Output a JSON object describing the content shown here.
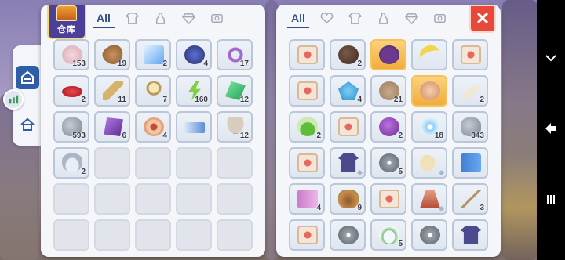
{
  "left_panel": {
    "warehouse_label": "仓库",
    "tabs": [
      {
        "label": "All",
        "active": true
      },
      {
        "icon": "shirt-icon"
      },
      {
        "icon": "bottle-icon"
      },
      {
        "icon": "gem-icon"
      },
      {
        "icon": "card-icon"
      }
    ],
    "slots": [
      {
        "icon": "i-unicorn",
        "qty": "153"
      },
      {
        "icon": "i-seed",
        "qty": "19"
      },
      {
        "icon": "i-blue",
        "qty": "2"
      },
      {
        "icon": "i-whale",
        "qty": "4"
      },
      {
        "icon": "i-swirl",
        "qty": "17"
      },
      {
        "icon": "i-ruby",
        "qty": "2"
      },
      {
        "icon": "i-feather",
        "qty": "11"
      },
      {
        "icon": "i-mirror",
        "qty": "7"
      },
      {
        "icon": "i-bolt",
        "qty": "160"
      },
      {
        "icon": "i-emerald",
        "qty": "12"
      },
      {
        "icon": "i-stone",
        "qty": "593"
      },
      {
        "icon": "i-purplecube",
        "qty": "6"
      },
      {
        "icon": "i-eye",
        "qty": "4"
      },
      {
        "icon": "i-ticket",
        "qty": ""
      },
      {
        "icon": "i-mushroom",
        "qty": "12"
      },
      {
        "icon": "i-bottle",
        "qty": "2"
      },
      {
        "empty": true
      },
      {
        "empty": true
      },
      {
        "empty": true
      },
      {
        "empty": true
      },
      {
        "empty": true
      },
      {
        "empty": true
      },
      {
        "empty": true
      },
      {
        "empty": true
      },
      {
        "empty": true
      },
      {
        "empty": true
      },
      {
        "empty": true
      },
      {
        "empty": true
      },
      {
        "empty": true
      },
      {
        "empty": true
      }
    ]
  },
  "right_panel": {
    "tabs": [
      {
        "label": "All",
        "active": true
      },
      {
        "icon": "heart-icon"
      },
      {
        "icon": "shirt-icon"
      },
      {
        "icon": "bottle-icon"
      },
      {
        "icon": "gem-icon"
      },
      {
        "icon": "card-icon"
      }
    ],
    "close_label": "✕",
    "slots": [
      {
        "icon": "i-scroll",
        "qty": ""
      },
      {
        "icon": "i-cookie",
        "qty": "2"
      },
      {
        "icon": "i-ghost",
        "qty": "",
        "gold": true
      },
      {
        "icon": "i-banana",
        "qty": ""
      },
      {
        "icon": "i-scroll",
        "qty": ""
      },
      {
        "icon": "i-scroll",
        "qty": ""
      },
      {
        "icon": "i-crystal",
        "qty": "4"
      },
      {
        "icon": "i-bag",
        "qty": "21"
      },
      {
        "icon": "i-creamy",
        "qty": "",
        "gold": true
      },
      {
        "icon": "i-bone",
        "qty": "2"
      },
      {
        "icon": "i-potion",
        "qty": "2"
      },
      {
        "icon": "i-scroll",
        "qty": ""
      },
      {
        "icon": "i-purple",
        "qty": "2"
      },
      {
        "icon": "i-star",
        "qty": "18"
      },
      {
        "icon": "i-stone",
        "qty": "343"
      },
      {
        "icon": "i-scroll",
        "qty": ""
      },
      {
        "icon": "i-shirt",
        "qty": "",
        "sparkle": true
      },
      {
        "icon": "i-disc",
        "qty": "5"
      },
      {
        "icon": "i-moon",
        "qty": "",
        "sparkle": true
      },
      {
        "icon": "i-book",
        "qty": ""
      },
      {
        "icon": "i-pinkbook",
        "qty": "4"
      },
      {
        "icon": "i-food",
        "qty": "9"
      },
      {
        "icon": "i-scroll",
        "qty": ""
      },
      {
        "icon": "i-cape",
        "qty": "",
        "sparkle": true
      },
      {
        "icon": "i-rod",
        "qty": "3"
      },
      {
        "icon": "i-scroll",
        "qty": ""
      },
      {
        "icon": "i-disc",
        "qty": ""
      },
      {
        "icon": "i-cap",
        "qty": "5"
      },
      {
        "icon": "i-disc",
        "qty": ""
      },
      {
        "icon": "i-shirt",
        "qty": ""
      }
    ]
  },
  "side": {
    "buttons": [
      "home-icon",
      "stats-icon",
      "house-icon"
    ]
  },
  "navbar": {
    "buttons": [
      "chevron-down-icon",
      "back-icon",
      "menu-icon"
    ]
  }
}
